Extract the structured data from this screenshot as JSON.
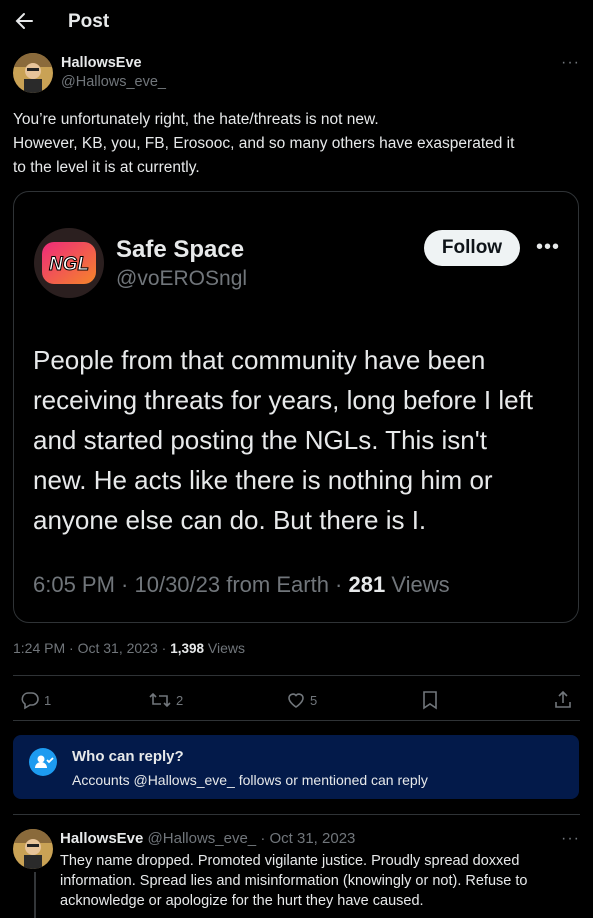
{
  "header": {
    "title": "Post"
  },
  "post": {
    "name": "HallowsEve",
    "handle": "@Hallows_eve_",
    "text_lines": [
      "You’re unfortunately right, the hate/threats is not new.",
      "However, KB, you, FB, Erosooc, and so many others have exasperated it",
      "to the level it is at currently."
    ],
    "time": "1:24 PM · Oct 31, 2023 · ",
    "views_count": "1,398",
    "views_label": " Views"
  },
  "quoted": {
    "avatar_text": "NGL",
    "name": "Safe Space",
    "handle": "@voEROSngl",
    "follow_label": "Follow",
    "text_lines": [
      "People from that community have been",
      "receiving threats for years, long before I left",
      "and started posting the NGLs. This isn't",
      "new. He acts like there is nothing him or",
      "anyone else can do. But there is I."
    ],
    "meta_prefix": "6:05 PM · 10/30/23 from Earth · ",
    "views_count": "281",
    "views_label": " Views"
  },
  "actions": {
    "replies": "1",
    "reposts": "2",
    "likes": "5"
  },
  "who_can_reply": {
    "title": "Who can reply?",
    "subtitle": "Accounts @Hallows_eve_ follows or mentioned can reply"
  },
  "reply": {
    "name": "HallowsEve",
    "handle_time": " @Hallows_eve_ · Oct 31, 2023",
    "text_lines": [
      "They name dropped. Promoted vigilante justice. Proudly spread doxxed",
      "information. Spread lies and misinformation (knowingly or not). Refuse to",
      "acknowledge or apologize for the hurt they have caused."
    ]
  },
  "colors": {
    "accent": "#1d9bf0",
    "background": "#000000",
    "muted": "#71767b",
    "banner": "#031a4a"
  }
}
